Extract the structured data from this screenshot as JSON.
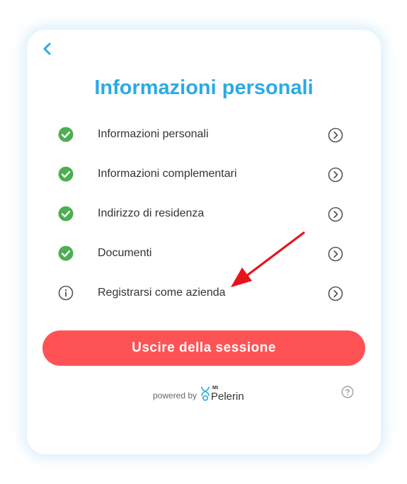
{
  "header": {
    "back_icon": "chevron-left-icon",
    "title": "Informazioni personali"
  },
  "steps": [
    {
      "label": "Informazioni personali",
      "status": "complete",
      "status_icon": "check-circle-icon"
    },
    {
      "label": "Informazioni complementari",
      "status": "complete",
      "status_icon": "check-circle-icon"
    },
    {
      "label": "Indirizzo di residenza",
      "status": "complete",
      "status_icon": "check-circle-icon"
    },
    {
      "label": "Documenti",
      "status": "complete",
      "status_icon": "check-circle-icon"
    },
    {
      "label": "Registrarsi come azienda",
      "status": "info",
      "status_icon": "info-circle-icon"
    }
  ],
  "logout_button": {
    "label": "Uscire della sessione"
  },
  "footer": {
    "powered_by": "powered by",
    "brand_prefix": "Mt",
    "brand_name": "Pelerin",
    "help_icon": "help-circle-icon"
  },
  "colors": {
    "accent": "#2ca9e6",
    "success": "#4caf50",
    "danger": "#ff5255",
    "annotation_arrow": "#e8141c"
  }
}
